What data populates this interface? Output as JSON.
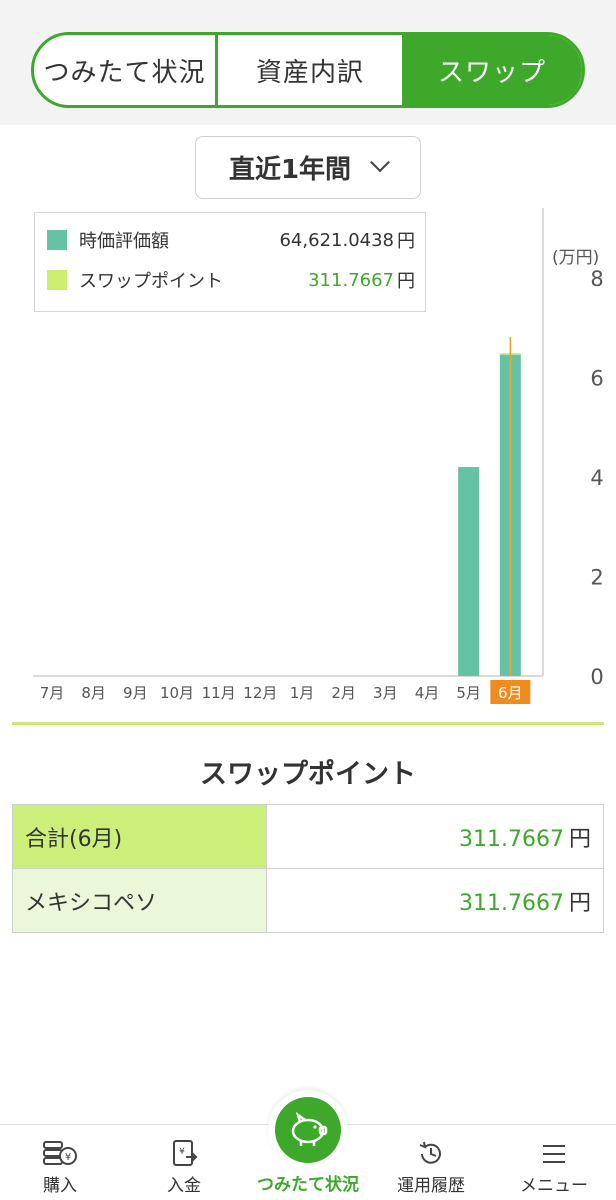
{
  "tabs": {
    "items": [
      {
        "label": "つみたて状況"
      },
      {
        "label": "資産内訳"
      },
      {
        "label": "スワップ"
      }
    ],
    "active_index": 2
  },
  "period": {
    "label": "直近1年間"
  },
  "legend": {
    "items": [
      {
        "label": "時価評価額",
        "value": "64,621.0438",
        "unit": "円",
        "color": "#66c2a5"
      },
      {
        "label": "スワップポイント",
        "value": "311.7667",
        "unit": "円",
        "color": "#cdef6f"
      }
    ]
  },
  "chart_data": {
    "type": "bar",
    "stacked": true,
    "categories": [
      "7月",
      "8月",
      "9月",
      "10月",
      "11月",
      "12月",
      "1月",
      "2月",
      "3月",
      "4月",
      "5月",
      "6月"
    ],
    "selected_category": "6月",
    "y_unit": "(万円)",
    "y_ticks": [
      0,
      2,
      4,
      6,
      8
    ],
    "ylim": [
      0,
      8
    ],
    "y_axis_position": "right",
    "grid": false,
    "series": [
      {
        "name": "時価評価額",
        "color": "#66c2a5",
        "values": [
          0,
          0,
          0,
          0,
          0,
          0,
          0,
          0,
          0,
          0,
          4.2,
          6.46
        ]
      },
      {
        "name": "スワップポイント",
        "color": "#cdef6f",
        "values": [
          0,
          0,
          0,
          0,
          0,
          0,
          0,
          0,
          0,
          0,
          0,
          0.03
        ]
      }
    ]
  },
  "swap_section": {
    "title": "スワップポイント",
    "rows": [
      {
        "label": "合計(6月)",
        "value": "311.7667",
        "unit": "円"
      },
      {
        "label": "メキシコペソ",
        "value": "311.7667",
        "unit": "円"
      }
    ]
  },
  "bottom_nav": {
    "items": [
      {
        "label": "購入",
        "icon": "purchase-icon"
      },
      {
        "label": "入金",
        "icon": "deposit-icon"
      },
      {
        "label": "つみたて状況",
        "icon": "piggy-bank-icon",
        "active": true
      },
      {
        "label": "運用履歴",
        "icon": "history-icon"
      },
      {
        "label": "メニュー",
        "icon": "menu-icon"
      }
    ]
  },
  "colors": {
    "accent": "#3ea82b",
    "selected_month_badge": "#f08c1e",
    "cursor_line": "#f0a030"
  }
}
